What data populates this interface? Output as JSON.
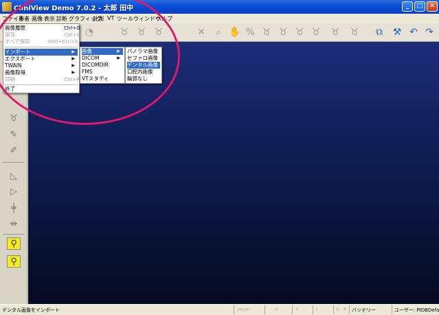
{
  "window": {
    "title": "CliniView Demo 7.0.2 - 太郎 田中",
    "minimize": "_",
    "maximize": "□",
    "close": "✕"
  },
  "menubar": [
    "ファイル",
    "患者",
    "画像",
    "表示",
    "診断",
    "グラフィック",
    "計測",
    "VT",
    "ツール",
    "ウィンドウ",
    "ヘルプ"
  ],
  "file_menu": {
    "items": [
      {
        "label": "画像履歴",
        "shortcut": "Ctrl+O"
      },
      {
        "label": "保存",
        "shortcut": "Ctrl+S"
      },
      {
        "label": "すべて保存",
        "shortcut": "Shift+Ctrl+S"
      },
      {
        "label": "インポート"
      },
      {
        "label": "エクスポート"
      },
      {
        "label": "TWAIN"
      },
      {
        "label": "画像取得"
      },
      {
        "label": "印刷",
        "shortcut": "Ctrl+P"
      },
      {
        "label": "終了"
      }
    ]
  },
  "import_submenu": [
    "画像",
    "DICOM",
    "DICOMDIR",
    "FMS",
    "VTスタディ"
  ],
  "image_submenu": [
    "パノラマ画像",
    "セファロ画像",
    "デンタル画像",
    "口腔内画像",
    "輪郭なし"
  ],
  "statusbar": {
    "message": "デンタル画像をインポート",
    "zoom": "zoom",
    "x": "X",
    "y": "Y",
    "i": "I",
    "o": "O",
    "p": "P",
    "battery": "バッテリー",
    "user": "ユーザー: PIDBDefault"
  },
  "icons": {
    "toolbar": [
      "open-icon",
      "tooth-icon",
      "tooth-icon",
      "tooth-icon",
      "fit-icon",
      "zoom-icon",
      "pan-icon",
      "magnify-icon",
      "tooth-icon",
      "tooth-icon",
      "tooth-icon",
      "tooth-icon",
      "tooth-icon",
      "tooth-icon",
      "compare-icon",
      "implant-icon",
      "undo-icon",
      "redo-icon"
    ],
    "left": [
      "tooth-icon",
      "scan-icon",
      "drawing-icon",
      "angle-icon",
      "triangle-icon",
      "ruler-icon",
      "distance-icon",
      "implant-yellow-icon",
      "implant-yellow-icon"
    ]
  },
  "colors": {
    "highlight": "#316ac5",
    "annotation_circle": "#e0186b",
    "yellow_tool": "#f6ef16"
  }
}
